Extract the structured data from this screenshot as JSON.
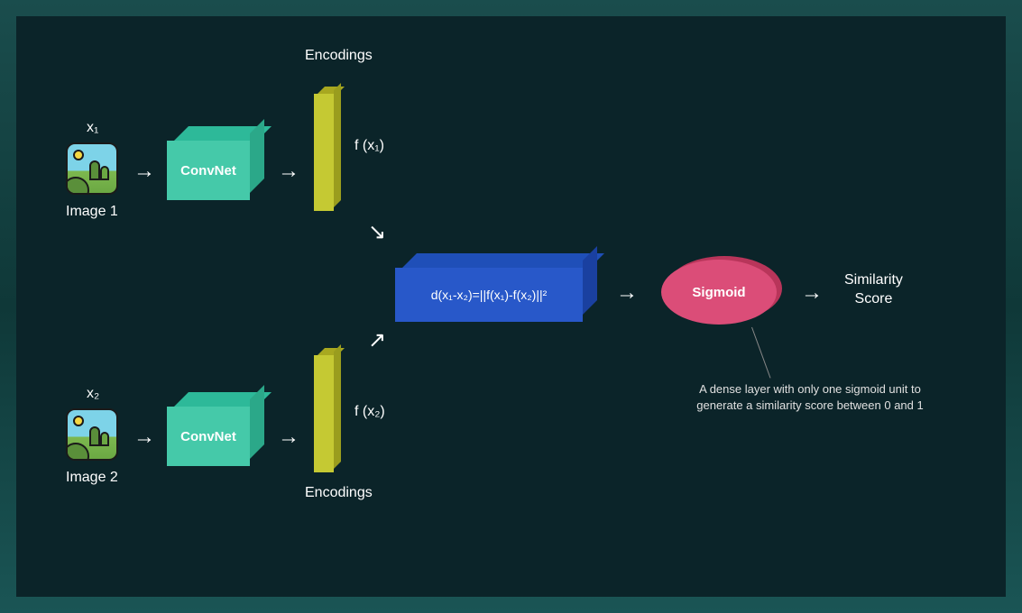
{
  "input1": {
    "var": "x₁",
    "caption": "Image 1"
  },
  "input2": {
    "var": "x₂",
    "caption": "Image 2"
  },
  "convnet": {
    "label": "ConvNet"
  },
  "encodings": {
    "title": "Encodings",
    "f1": "f (x₁)",
    "f2": "f (x₂)"
  },
  "distance": {
    "formula": "d(x₁-x₂)=||f(x₁)-f(x₂)||²"
  },
  "sigmoid": {
    "label": "Sigmoid",
    "note": "A dense layer with only one sigmoid unit to generate a similarity score between 0 and 1"
  },
  "output": {
    "label": "Similarity Score"
  },
  "arrows": {
    "right": "→",
    "downright": "↘",
    "upright": "↗"
  }
}
